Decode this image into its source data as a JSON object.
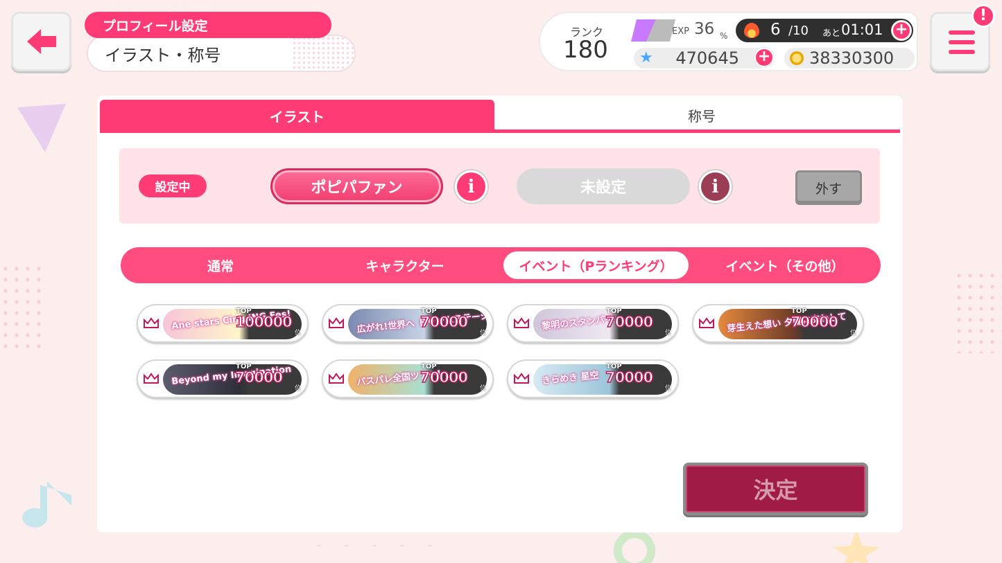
{
  "header": {
    "section_label": "プロフィール設定",
    "page_title": "イラスト・称号"
  },
  "status": {
    "rank_label": "ランク",
    "rank_value": "180",
    "exp_label": "EXP",
    "exp_value": "36",
    "exp_unit": "%",
    "stamina_current": "6",
    "stamina_max": "/10",
    "stamina_remaining_label": "あと",
    "stamina_timer": "01:01",
    "star_gems": "470645",
    "coins": "38330300",
    "notification_mark": "!"
  },
  "tabs": [
    {
      "label": "イラスト",
      "active": true
    },
    {
      "label": "称号",
      "active": false
    }
  ],
  "current": {
    "tag": "設定中",
    "title_1": "ポピパファン",
    "title_2": "未設定",
    "remove_label": "外す"
  },
  "filters": [
    {
      "label": "通常",
      "active": false
    },
    {
      "label": "キャラクター",
      "active": false
    },
    {
      "label": "イベント（Pランキング）",
      "active": true
    },
    {
      "label": "イベント（その他）",
      "active": false
    }
  ],
  "badges": [
    {
      "art": "Ane stars Cing ING Fes!",
      "top": "TOP",
      "rank": "100000",
      "suffix": "位",
      "colors": [
        "#f7c4d9",
        "#fff5c9"
      ]
    },
    {
      "art": "広がれ!世界へ ドリームステージ",
      "top": "TOP",
      "rank": "70000",
      "suffix": "位",
      "colors": [
        "#7a8ab0",
        "#c7d3e6"
      ]
    },
    {
      "art": "黎明のスタンバイ",
      "top": "TOP",
      "rank": "70000",
      "suffix": "位",
      "colors": [
        "#cfc6d9",
        "#efe9f2"
      ]
    },
    {
      "art": "芽生えた想い 夕陽に交わして",
      "top": "TOP",
      "rank": "70000",
      "suffix": "位",
      "colors": [
        "#e58a3c",
        "#6b3a28"
      ]
    },
    {
      "art": "Beyond my Imagination",
      "top": "TOP",
      "rank": "70000",
      "suffix": "位",
      "colors": [
        "#5c5c6e",
        "#2f2f3a"
      ]
    },
    {
      "art": "パスパレ全国ツアー!",
      "top": "TOP",
      "rank": "70000",
      "suffix": "位",
      "colors": [
        "#f0b26a",
        "#a8e0d2"
      ]
    },
    {
      "art": "きらめき 星空",
      "top": "TOP",
      "rank": "70000",
      "suffix": "位",
      "colors": [
        "#d6eaf3",
        "#9cc5d8"
      ]
    }
  ],
  "decide_label": "決定",
  "colors": {
    "accent": "#ff3b75",
    "accent_dark": "#a01c47",
    "background": "#fdeeee"
  }
}
